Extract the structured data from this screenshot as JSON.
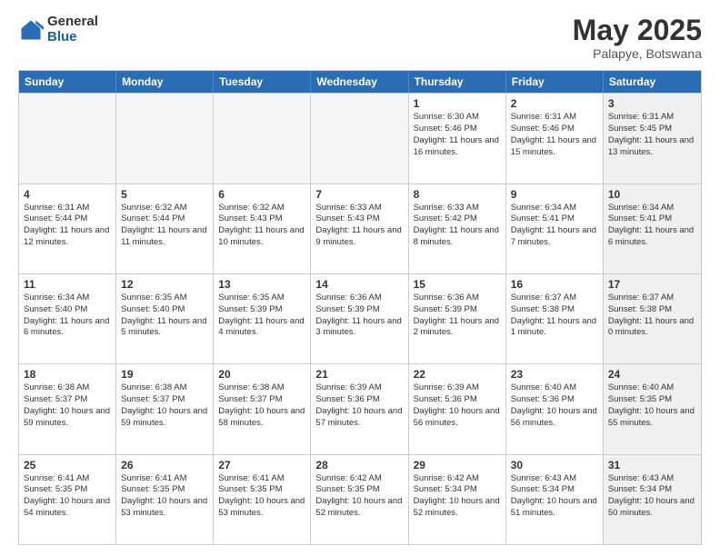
{
  "logo": {
    "general": "General",
    "blue": "Blue"
  },
  "header": {
    "title": "May 2025",
    "subtitle": "Palapye, Botswana"
  },
  "days_of_week": [
    "Sunday",
    "Monday",
    "Tuesday",
    "Wednesday",
    "Thursday",
    "Friday",
    "Saturday"
  ],
  "rows": [
    [
      {
        "num": "",
        "info": "",
        "empty": true
      },
      {
        "num": "",
        "info": "",
        "empty": true
      },
      {
        "num": "",
        "info": "",
        "empty": true
      },
      {
        "num": "",
        "info": "",
        "empty": true
      },
      {
        "num": "1",
        "info": "Sunrise: 6:30 AM\nSunset: 5:46 PM\nDaylight: 11 hours\nand 16 minutes."
      },
      {
        "num": "2",
        "info": "Sunrise: 6:31 AM\nSunset: 5:46 PM\nDaylight: 11 hours\nand 15 minutes."
      },
      {
        "num": "3",
        "info": "Sunrise: 6:31 AM\nSunset: 5:45 PM\nDaylight: 11 hours\nand 13 minutes.",
        "shaded": true
      }
    ],
    [
      {
        "num": "4",
        "info": "Sunrise: 6:31 AM\nSunset: 5:44 PM\nDaylight: 11 hours\nand 12 minutes."
      },
      {
        "num": "5",
        "info": "Sunrise: 6:32 AM\nSunset: 5:44 PM\nDaylight: 11 hours\nand 11 minutes."
      },
      {
        "num": "6",
        "info": "Sunrise: 6:32 AM\nSunset: 5:43 PM\nDaylight: 11 hours\nand 10 minutes."
      },
      {
        "num": "7",
        "info": "Sunrise: 6:33 AM\nSunset: 5:43 PM\nDaylight: 11 hours\nand 9 minutes."
      },
      {
        "num": "8",
        "info": "Sunrise: 6:33 AM\nSunset: 5:42 PM\nDaylight: 11 hours\nand 8 minutes."
      },
      {
        "num": "9",
        "info": "Sunrise: 6:34 AM\nSunset: 5:41 PM\nDaylight: 11 hours\nand 7 minutes."
      },
      {
        "num": "10",
        "info": "Sunrise: 6:34 AM\nSunset: 5:41 PM\nDaylight: 11 hours\nand 6 minutes.",
        "shaded": true
      }
    ],
    [
      {
        "num": "11",
        "info": "Sunrise: 6:34 AM\nSunset: 5:40 PM\nDaylight: 11 hours\nand 6 minutes."
      },
      {
        "num": "12",
        "info": "Sunrise: 6:35 AM\nSunset: 5:40 PM\nDaylight: 11 hours\nand 5 minutes."
      },
      {
        "num": "13",
        "info": "Sunrise: 6:35 AM\nSunset: 5:39 PM\nDaylight: 11 hours\nand 4 minutes."
      },
      {
        "num": "14",
        "info": "Sunrise: 6:36 AM\nSunset: 5:39 PM\nDaylight: 11 hours\nand 3 minutes."
      },
      {
        "num": "15",
        "info": "Sunrise: 6:36 AM\nSunset: 5:39 PM\nDaylight: 11 hours\nand 2 minutes."
      },
      {
        "num": "16",
        "info": "Sunrise: 6:37 AM\nSunset: 5:38 PM\nDaylight: 11 hours\nand 1 minute."
      },
      {
        "num": "17",
        "info": "Sunrise: 6:37 AM\nSunset: 5:38 PM\nDaylight: 11 hours\nand 0 minutes.",
        "shaded": true
      }
    ],
    [
      {
        "num": "18",
        "info": "Sunrise: 6:38 AM\nSunset: 5:37 PM\nDaylight: 10 hours\nand 59 minutes."
      },
      {
        "num": "19",
        "info": "Sunrise: 6:38 AM\nSunset: 5:37 PM\nDaylight: 10 hours\nand 59 minutes."
      },
      {
        "num": "20",
        "info": "Sunrise: 6:38 AM\nSunset: 5:37 PM\nDaylight: 10 hours\nand 58 minutes."
      },
      {
        "num": "21",
        "info": "Sunrise: 6:39 AM\nSunset: 5:36 PM\nDaylight: 10 hours\nand 57 minutes."
      },
      {
        "num": "22",
        "info": "Sunrise: 6:39 AM\nSunset: 5:36 PM\nDaylight: 10 hours\nand 56 minutes."
      },
      {
        "num": "23",
        "info": "Sunrise: 6:40 AM\nSunset: 5:36 PM\nDaylight: 10 hours\nand 56 minutes."
      },
      {
        "num": "24",
        "info": "Sunrise: 6:40 AM\nSunset: 5:35 PM\nDaylight: 10 hours\nand 55 minutes.",
        "shaded": true
      }
    ],
    [
      {
        "num": "25",
        "info": "Sunrise: 6:41 AM\nSunset: 5:35 PM\nDaylight: 10 hours\nand 54 minutes."
      },
      {
        "num": "26",
        "info": "Sunrise: 6:41 AM\nSunset: 5:35 PM\nDaylight: 10 hours\nand 53 minutes."
      },
      {
        "num": "27",
        "info": "Sunrise: 6:41 AM\nSunset: 5:35 PM\nDaylight: 10 hours\nand 53 minutes."
      },
      {
        "num": "28",
        "info": "Sunrise: 6:42 AM\nSunset: 5:35 PM\nDaylight: 10 hours\nand 52 minutes."
      },
      {
        "num": "29",
        "info": "Sunrise: 6:42 AM\nSunset: 5:34 PM\nDaylight: 10 hours\nand 52 minutes."
      },
      {
        "num": "30",
        "info": "Sunrise: 6:43 AM\nSunset: 5:34 PM\nDaylight: 10 hours\nand 51 minutes."
      },
      {
        "num": "31",
        "info": "Sunrise: 6:43 AM\nSunset: 5:34 PM\nDaylight: 10 hours\nand 50 minutes.",
        "shaded": true
      }
    ]
  ]
}
